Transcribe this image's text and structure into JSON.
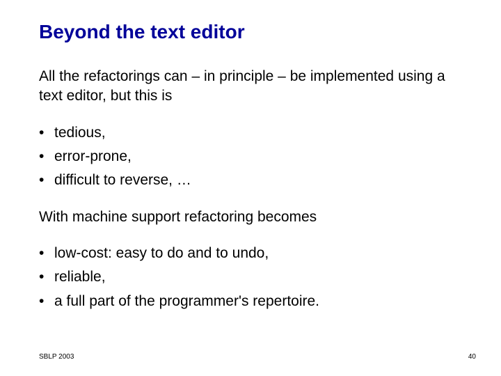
{
  "title": "Beyond the text editor",
  "intro": "All the refactorings can – in principle – be implemented using a text editor, but this is",
  "bullets1": [
    "tedious,",
    "error-prone,",
    "difficult to reverse, …"
  ],
  "mid": "With machine support refactoring becomes",
  "bullets2": [
    "low-cost: easy to do and to undo,",
    "reliable,",
    "a full part of the programmer's repertoire."
  ],
  "footer": {
    "left": "SBLP 2003",
    "right": "40"
  }
}
